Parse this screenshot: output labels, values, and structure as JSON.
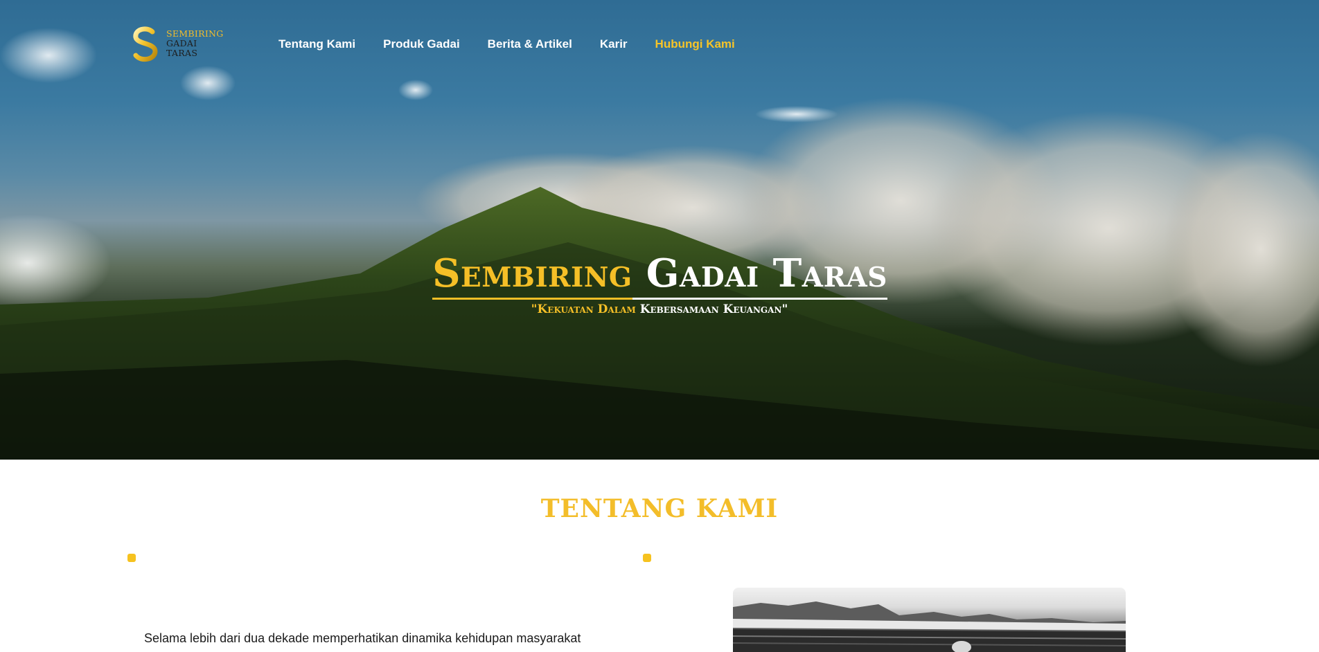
{
  "brand": {
    "line1": "SEMBIRING",
    "line2": "GADAI",
    "line3": "TARAS",
    "mark": "S",
    "gold": "#f5bf27"
  },
  "nav": {
    "items": [
      {
        "label": "Tentang Kami",
        "active": false
      },
      {
        "label": "Produk Gadai",
        "active": false
      },
      {
        "label": "Berita & Artikel",
        "active": false
      },
      {
        "label": "Karir",
        "active": false
      },
      {
        "label": "Hubungi Kami",
        "active": true
      }
    ]
  },
  "hero": {
    "title_gold": "Sembiring",
    "title_white": "Gadai Taras",
    "tagline_gold": "\"Kekuatan Dalam",
    "tagline_white": "Kebersamaan Keuangan\""
  },
  "about": {
    "heading": "TENTANG KAMI",
    "paragraph_start": "Selama lebih dari dua dekade memperhatikan dinamika kehidupan masyarakat"
  }
}
